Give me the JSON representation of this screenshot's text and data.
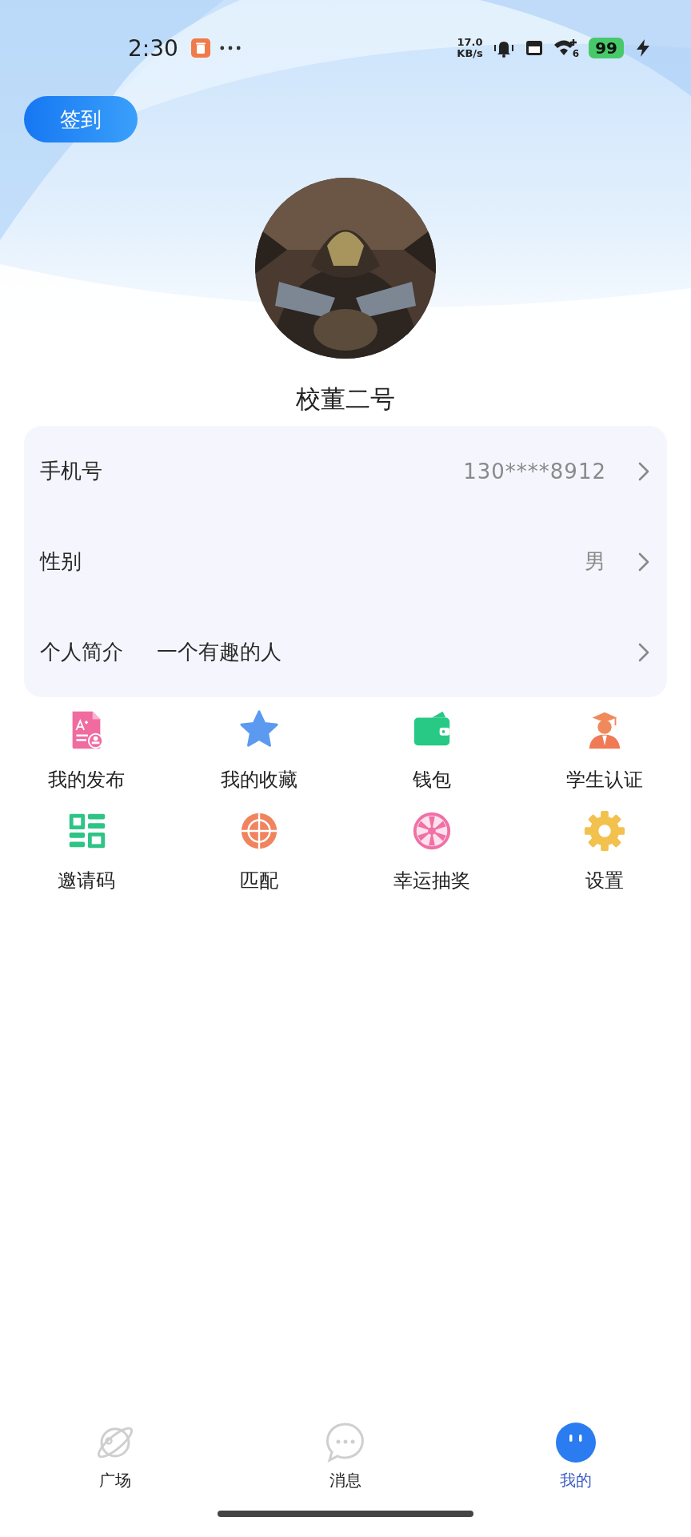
{
  "status_bar": {
    "time": "2:30",
    "net_speed_value": "17.0",
    "net_speed_unit": "KB/s",
    "wifi_badge": "6",
    "battery": "99",
    "charging": true
  },
  "checkin_button": "签到",
  "profile": {
    "nickname": "校董二号"
  },
  "info_rows": [
    {
      "kind": "right",
      "label": "手机号",
      "value": "130****8912"
    },
    {
      "kind": "right",
      "label": "性别",
      "value": "男"
    },
    {
      "kind": "inline",
      "label": "个人简介",
      "value": "一个有趣的人"
    }
  ],
  "features": [
    {
      "label": "我的发布"
    },
    {
      "label": "我的收藏"
    },
    {
      "label": "钱包"
    },
    {
      "label": "学生认证"
    },
    {
      "label": "邀请码"
    },
    {
      "label": "匹配"
    },
    {
      "label": "幸运抽奖"
    },
    {
      "label": "设置"
    }
  ],
  "tab_bar": [
    {
      "label": "广场",
      "selected": false
    },
    {
      "label": "消息",
      "selected": false
    },
    {
      "label": "我的",
      "selected": true
    }
  ]
}
